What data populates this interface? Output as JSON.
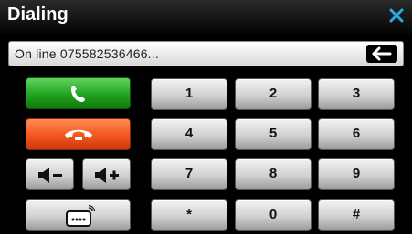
{
  "window": {
    "title": "Dialing"
  },
  "display": {
    "text": "On line 075582536466..."
  },
  "keypad": {
    "keys": [
      "1",
      "2",
      "3",
      "4",
      "5",
      "6",
      "7",
      "8",
      "9",
      "*",
      "0",
      "#"
    ]
  },
  "controls": {
    "call_icon": "phone-call-icon",
    "hangup_icon": "phone-hangup-icon",
    "volume_down_icon": "volume-down-icon",
    "volume_up_icon": "volume-up-icon",
    "keyboard_icon": "keypad-toggle-icon"
  },
  "colors": {
    "call": "#22a21f",
    "hangup": "#f4561e",
    "close": "#2aa8e0"
  }
}
